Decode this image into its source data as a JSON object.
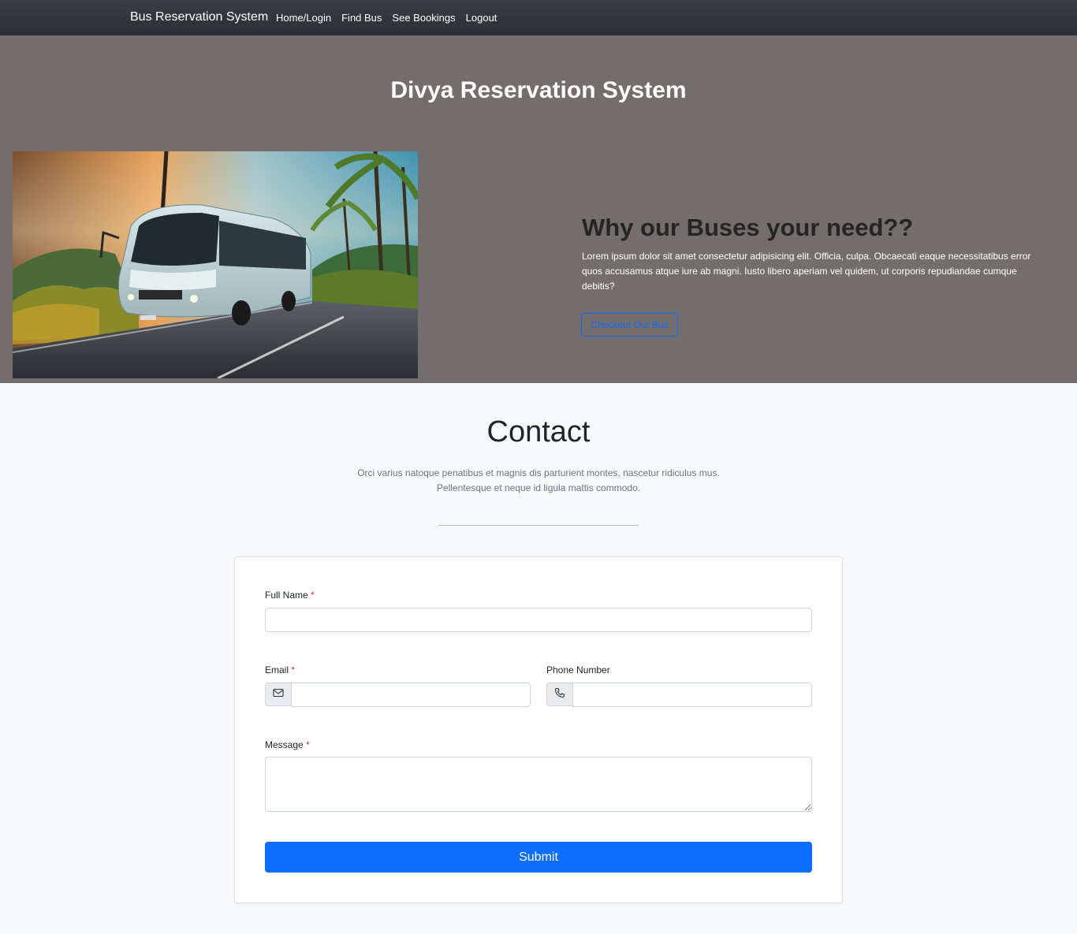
{
  "navbar": {
    "brand": "Bus Reservation System",
    "links": [
      "Home/Login",
      "Find Bus",
      "See Bookings",
      "Logout"
    ]
  },
  "hero": {
    "title": "Divya Reservation System",
    "why_title": "Why our Buses your need??",
    "why_text": "Lorem ipsum dolor sit amet consectetur adipisicing elit. Officia, culpa. Obcaecati eaque necessitatibus error quos accusamus atque iure ab magni. Iusto libero aperiam vel quidem, ut corporis repudiandae cumque debitis?",
    "cta_label": "Checkout Our Bus"
  },
  "contact": {
    "title": "Contact",
    "subtitle": "Orci varius natoque penatibus et magnis dis parturient montes, nascetur ridiculus mus. Pellentesque et neque id ligula mattis commodo.",
    "form": {
      "full_name_label": "Full Name",
      "full_name_value": "",
      "email_label": "Email",
      "email_value": "",
      "phone_label": "Phone Number",
      "phone_value": "",
      "message_label": "Message",
      "message_value": "",
      "required_mark": "*",
      "submit_label": "Submit"
    }
  },
  "colors": {
    "navbar": "#2f3236",
    "hero_bg": "#736e6d",
    "primary": "#0d6efd",
    "required": "#dc3545",
    "page_bg": "#f8f9fa"
  }
}
